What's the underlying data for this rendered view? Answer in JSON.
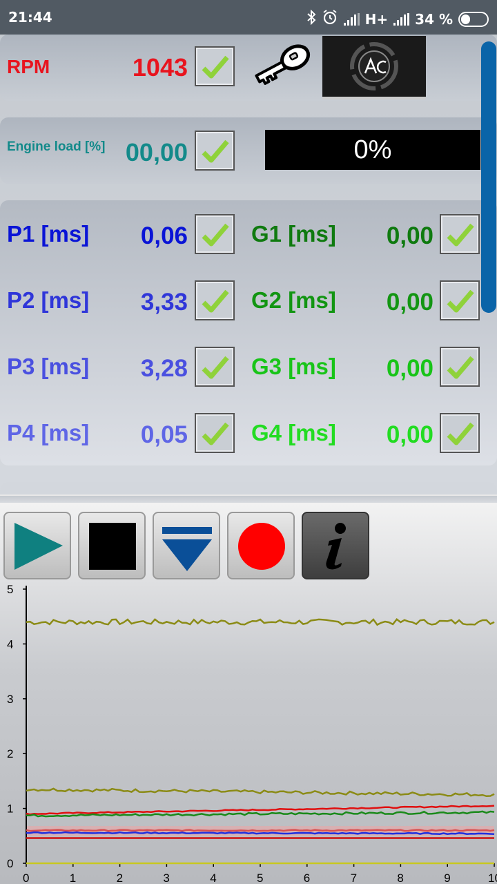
{
  "status_bar": {
    "time": "21:44",
    "network": "H+",
    "battery": "34 %"
  },
  "rpm": {
    "label": "RPM",
    "value": "1043",
    "checked": true
  },
  "engine_load": {
    "label": "Engine load [%]",
    "value": "00,00",
    "checked": true,
    "progress_text": "0%",
    "progress_fraction": 0
  },
  "injectors": [
    {
      "label": "P1 [ms]",
      "value": "0,06",
      "color": "#0a14d6"
    },
    {
      "label": "P2 [ms]",
      "value": "3,33",
      "color": "#2f36d9"
    },
    {
      "label": "P3 [ms]",
      "value": "3,28",
      "color": "#4a50e0"
    },
    {
      "label": "P4 [ms]",
      "value": "0,05",
      "color": "#5f66e6"
    }
  ],
  "gas_injectors": [
    {
      "label": "G1 [ms]",
      "value": "0,00",
      "color": "#0f7a0f"
    },
    {
      "label": "G2 [ms]",
      "value": "0,00",
      "color": "#129512"
    },
    {
      "label": "G3 [ms]",
      "value": "0,00",
      "color": "#18c418"
    },
    {
      "label": "G4 [ms]",
      "value": "0,00",
      "color": "#22dc22"
    }
  ],
  "toolbar": {
    "buttons": [
      "play",
      "stop",
      "download",
      "record",
      "info"
    ]
  },
  "icons": {
    "key": "key-icon",
    "logo": "ac-logo",
    "check": "checkmark-icon"
  },
  "colors": {
    "rpm": "#e8141e",
    "engine_load": "#138a8a",
    "accent_scroll": "#0a64a8"
  },
  "chart_data": {
    "type": "line",
    "xlim": [
      0,
      10
    ],
    "ylim": [
      0,
      5
    ],
    "x_ticks": [
      "0",
      "1",
      "2",
      "3",
      "4",
      "5",
      "6",
      "7",
      "8",
      "9",
      "10"
    ],
    "y_ticks": [
      "0",
      "1",
      "2",
      "3",
      "4",
      "5"
    ],
    "series": [
      {
        "color": "#8b8b16",
        "start": 4.4,
        "end": 4.4,
        "noise": 0.05
      },
      {
        "color": "#8b8b16",
        "start": 1.35,
        "end": 1.25,
        "noise": 0.03
      },
      {
        "color": "#e01010",
        "start": 0.9,
        "end": 1.05,
        "noise": 0.01
      },
      {
        "color": "#1a8a1a",
        "start": 0.87,
        "end": 0.93,
        "noise": 0.02
      },
      {
        "color": "#d85050",
        "start": 0.6,
        "end": 0.6,
        "noise": 0.01
      },
      {
        "color": "#2030e0",
        "start": 0.56,
        "end": 0.54,
        "noise": 0.01
      },
      {
        "color": "#d01010",
        "start": 0.46,
        "end": 0.46,
        "noise": 0.0
      },
      {
        "color": "#c8c820",
        "start": 0.0,
        "end": 0.0,
        "noise": 0.0
      }
    ]
  }
}
